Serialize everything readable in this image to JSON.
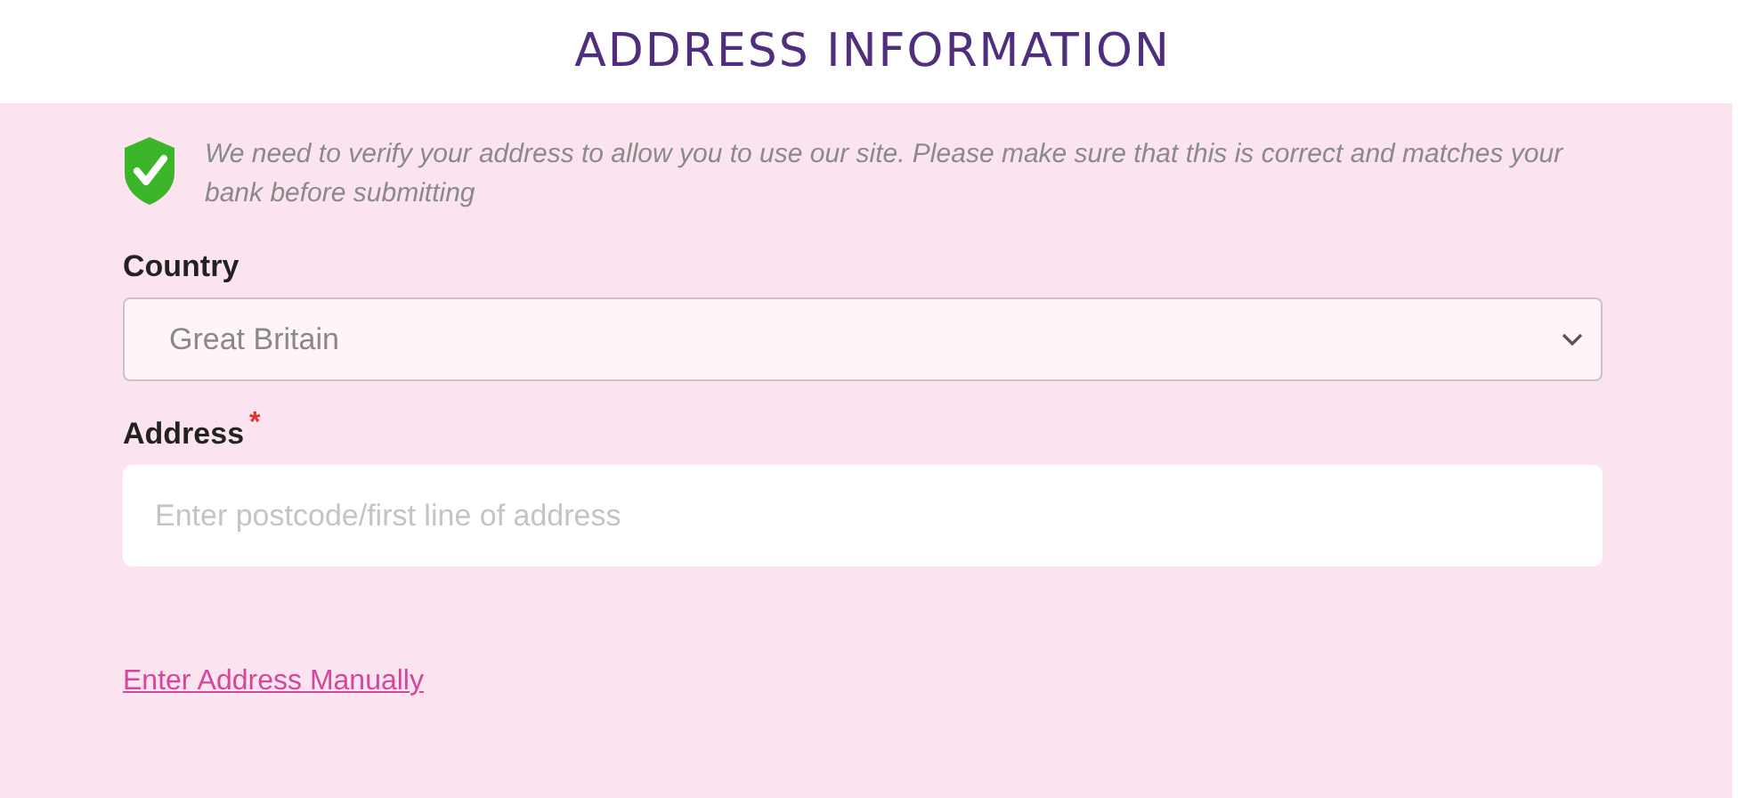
{
  "title": "ADDRESS INFORMATION",
  "notice": {
    "text": "We need to verify your address to allow you to use our site. Please make sure that this is correct and matches your bank before submitting"
  },
  "country": {
    "label": "Country",
    "value": "Great Britain"
  },
  "address": {
    "label": "Address",
    "required_mark": "*",
    "placeholder": "Enter postcode/first line of address"
  },
  "manual_link": "Enter Address Manually"
}
